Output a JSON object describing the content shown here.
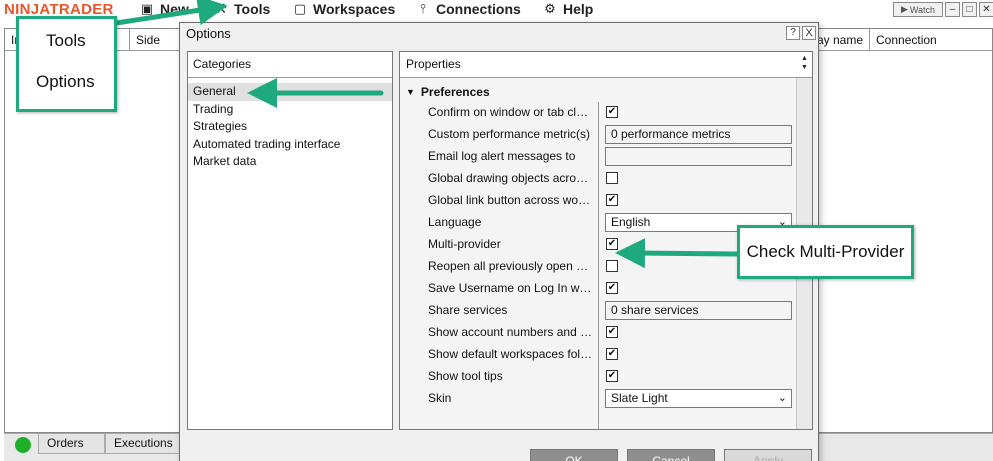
{
  "app": {
    "logo": "NINJATRADER"
  },
  "menu": [
    {
      "label": "New",
      "icon": "new-window-icon"
    },
    {
      "label": "Tools",
      "icon": "tools-icon"
    },
    {
      "label": "Workspaces",
      "icon": "workspaces-icon"
    },
    {
      "label": "Connections",
      "icon": "plug-icon"
    },
    {
      "label": "Help",
      "icon": "help-icon"
    }
  ],
  "window_controls": {
    "watch": "Watch"
  },
  "grid": {
    "columns": [
      "In",
      "Side",
      "ay name",
      "Connection"
    ]
  },
  "bottom_tabs": [
    "Orders",
    "Executions"
  ],
  "dialog": {
    "title": "Options",
    "help": "?",
    "close": "X",
    "categories_header": "Categories",
    "categories": [
      "General",
      "Trading",
      "Strategies",
      "Automated trading interface",
      "Market data"
    ],
    "selected_category": "General",
    "properties_header": "Properties",
    "section": "Preferences",
    "rows": [
      {
        "label": "Confirm on window or tab close",
        "type": "checkbox",
        "checked": true
      },
      {
        "label": "Custom performance metric(s)",
        "type": "field",
        "value": "0 performance metrics"
      },
      {
        "label": "Email log alert messages to",
        "type": "field",
        "value": ""
      },
      {
        "label": "Global drawing objects across...",
        "type": "checkbox",
        "checked": false
      },
      {
        "label": "Global link button across work...",
        "type": "checkbox",
        "checked": true
      },
      {
        "label": "Language",
        "type": "select",
        "value": "English"
      },
      {
        "label": "Multi-provider",
        "type": "checkbox",
        "checked": true
      },
      {
        "label": "Reopen all previously open wo...",
        "type": "checkbox",
        "checked": false
      },
      {
        "label": "Save Username on Log In win...",
        "type": "checkbox",
        "checked": true
      },
      {
        "label": "Share services",
        "type": "field",
        "value": "0 share services"
      },
      {
        "label": "Show account numbers and b...",
        "type": "checkbox",
        "checked": true
      },
      {
        "label": "Show default workspaces folder",
        "type": "checkbox",
        "checked": true
      },
      {
        "label": "Show tool tips",
        "type": "checkbox",
        "checked": true
      },
      {
        "label": "Skin",
        "type": "select",
        "value": "Slate Light"
      }
    ],
    "buttons": {
      "ok": "OK",
      "cancel": "Cancel",
      "apply": "Apply"
    }
  },
  "annotations": {
    "tools_line1": "Tools",
    "tools_line2": "Options",
    "multi": "Check Multi-Provider",
    "accent_color": "#1fa97f"
  }
}
